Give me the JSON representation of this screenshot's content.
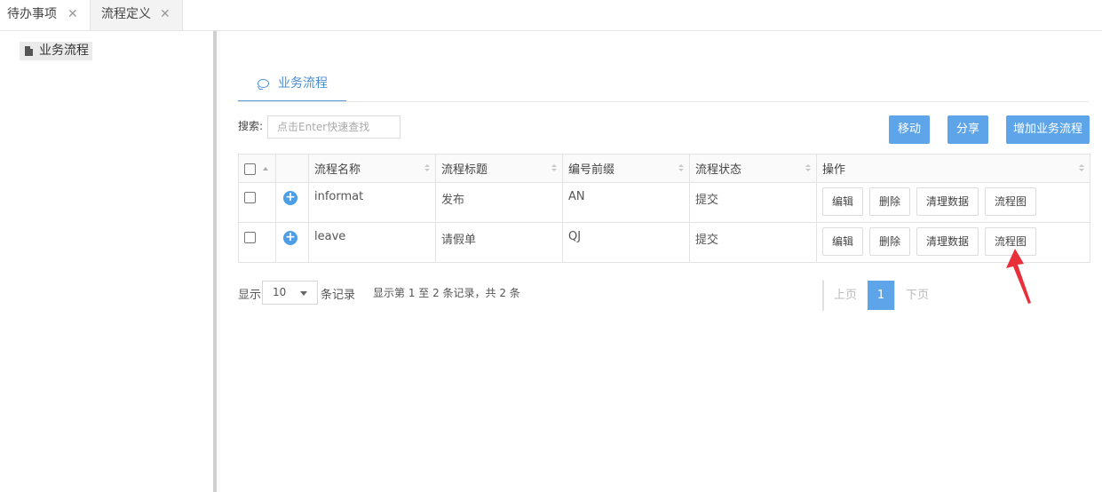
{
  "tabs": [
    {
      "label": "待办事项",
      "close": "✕"
    },
    {
      "label": "流程定义",
      "close": "✕"
    }
  ],
  "sidebar": {
    "tree": [
      {
        "label": "业务流程",
        "icon": "file-icon"
      }
    ]
  },
  "main": {
    "section_tab": {
      "label": "业务流程",
      "icon": "chat-bubble-icon"
    },
    "search": {
      "label": "搜索:",
      "placeholder": "点击Enter快速查找",
      "value": ""
    },
    "toolbar": {
      "move": "移动",
      "share": "分享",
      "add": "增加业务流程"
    },
    "table": {
      "columns": [
        "流程名称",
        "流程标题",
        "编号前缀",
        "流程状态",
        "操作"
      ],
      "rows": [
        {
          "name": "informat",
          "title": "发布",
          "prefix": "AN",
          "status": "提交",
          "actions": [
            "编辑",
            "删除",
            "清理数据",
            "流程图"
          ]
        },
        {
          "name": "leave",
          "title": "请假单",
          "prefix": "QJ",
          "status": "提交",
          "actions": [
            "编辑",
            "删除",
            "清理数据",
            "流程图"
          ]
        }
      ]
    },
    "footer": {
      "show": "显示",
      "page_size": "10",
      "records": "条记录",
      "summary": "显示第 1 至 2 条记录，共 2 条",
      "prev": "上页",
      "current_page": "1",
      "next": "下页"
    }
  },
  "colors": {
    "accent": "#5da5e8",
    "arrow": "#e8303a"
  }
}
